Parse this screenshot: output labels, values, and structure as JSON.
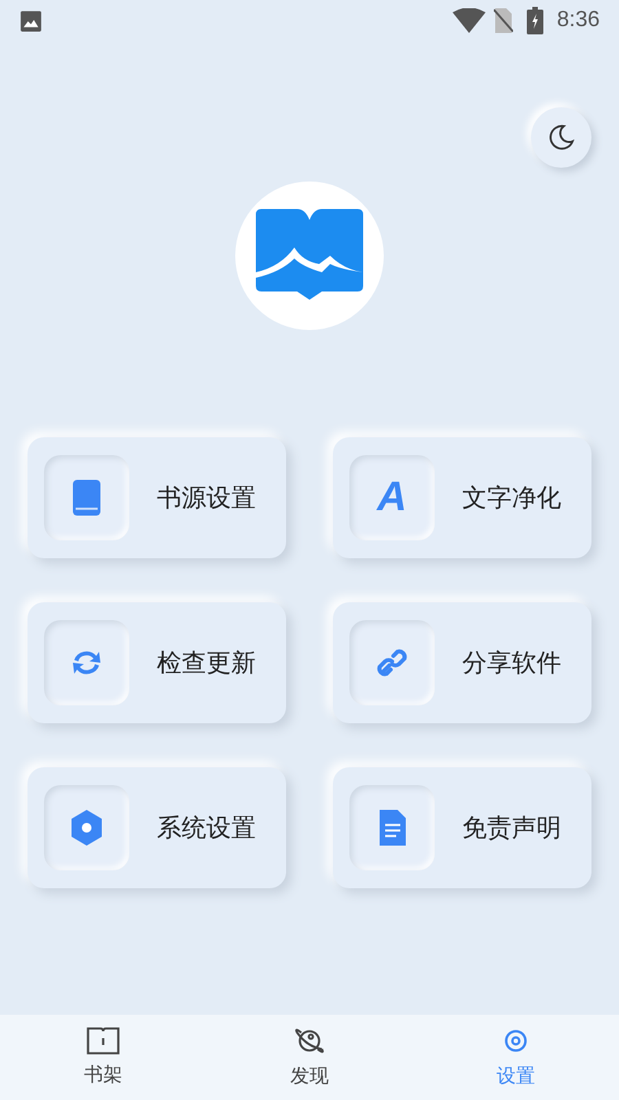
{
  "status_bar": {
    "time": "8:36"
  },
  "theme_toggle": {
    "kind": "moon"
  },
  "menu": [
    {
      "label": "书源设置",
      "kind": "book"
    },
    {
      "label": "文字净化",
      "kind": "letter",
      "glyph": "A"
    },
    {
      "label": "检查更新",
      "kind": "refresh"
    },
    {
      "label": "分享软件",
      "kind": "link"
    },
    {
      "label": "系统设置",
      "kind": "hexagon"
    },
    {
      "label": "免责声明",
      "kind": "document"
    }
  ],
  "bottom_nav": [
    {
      "label": "书架",
      "kind": "shelf",
      "selected": false
    },
    {
      "label": "发现",
      "kind": "planet",
      "selected": false
    },
    {
      "label": "设置",
      "kind": "gear",
      "selected": true
    }
  ]
}
